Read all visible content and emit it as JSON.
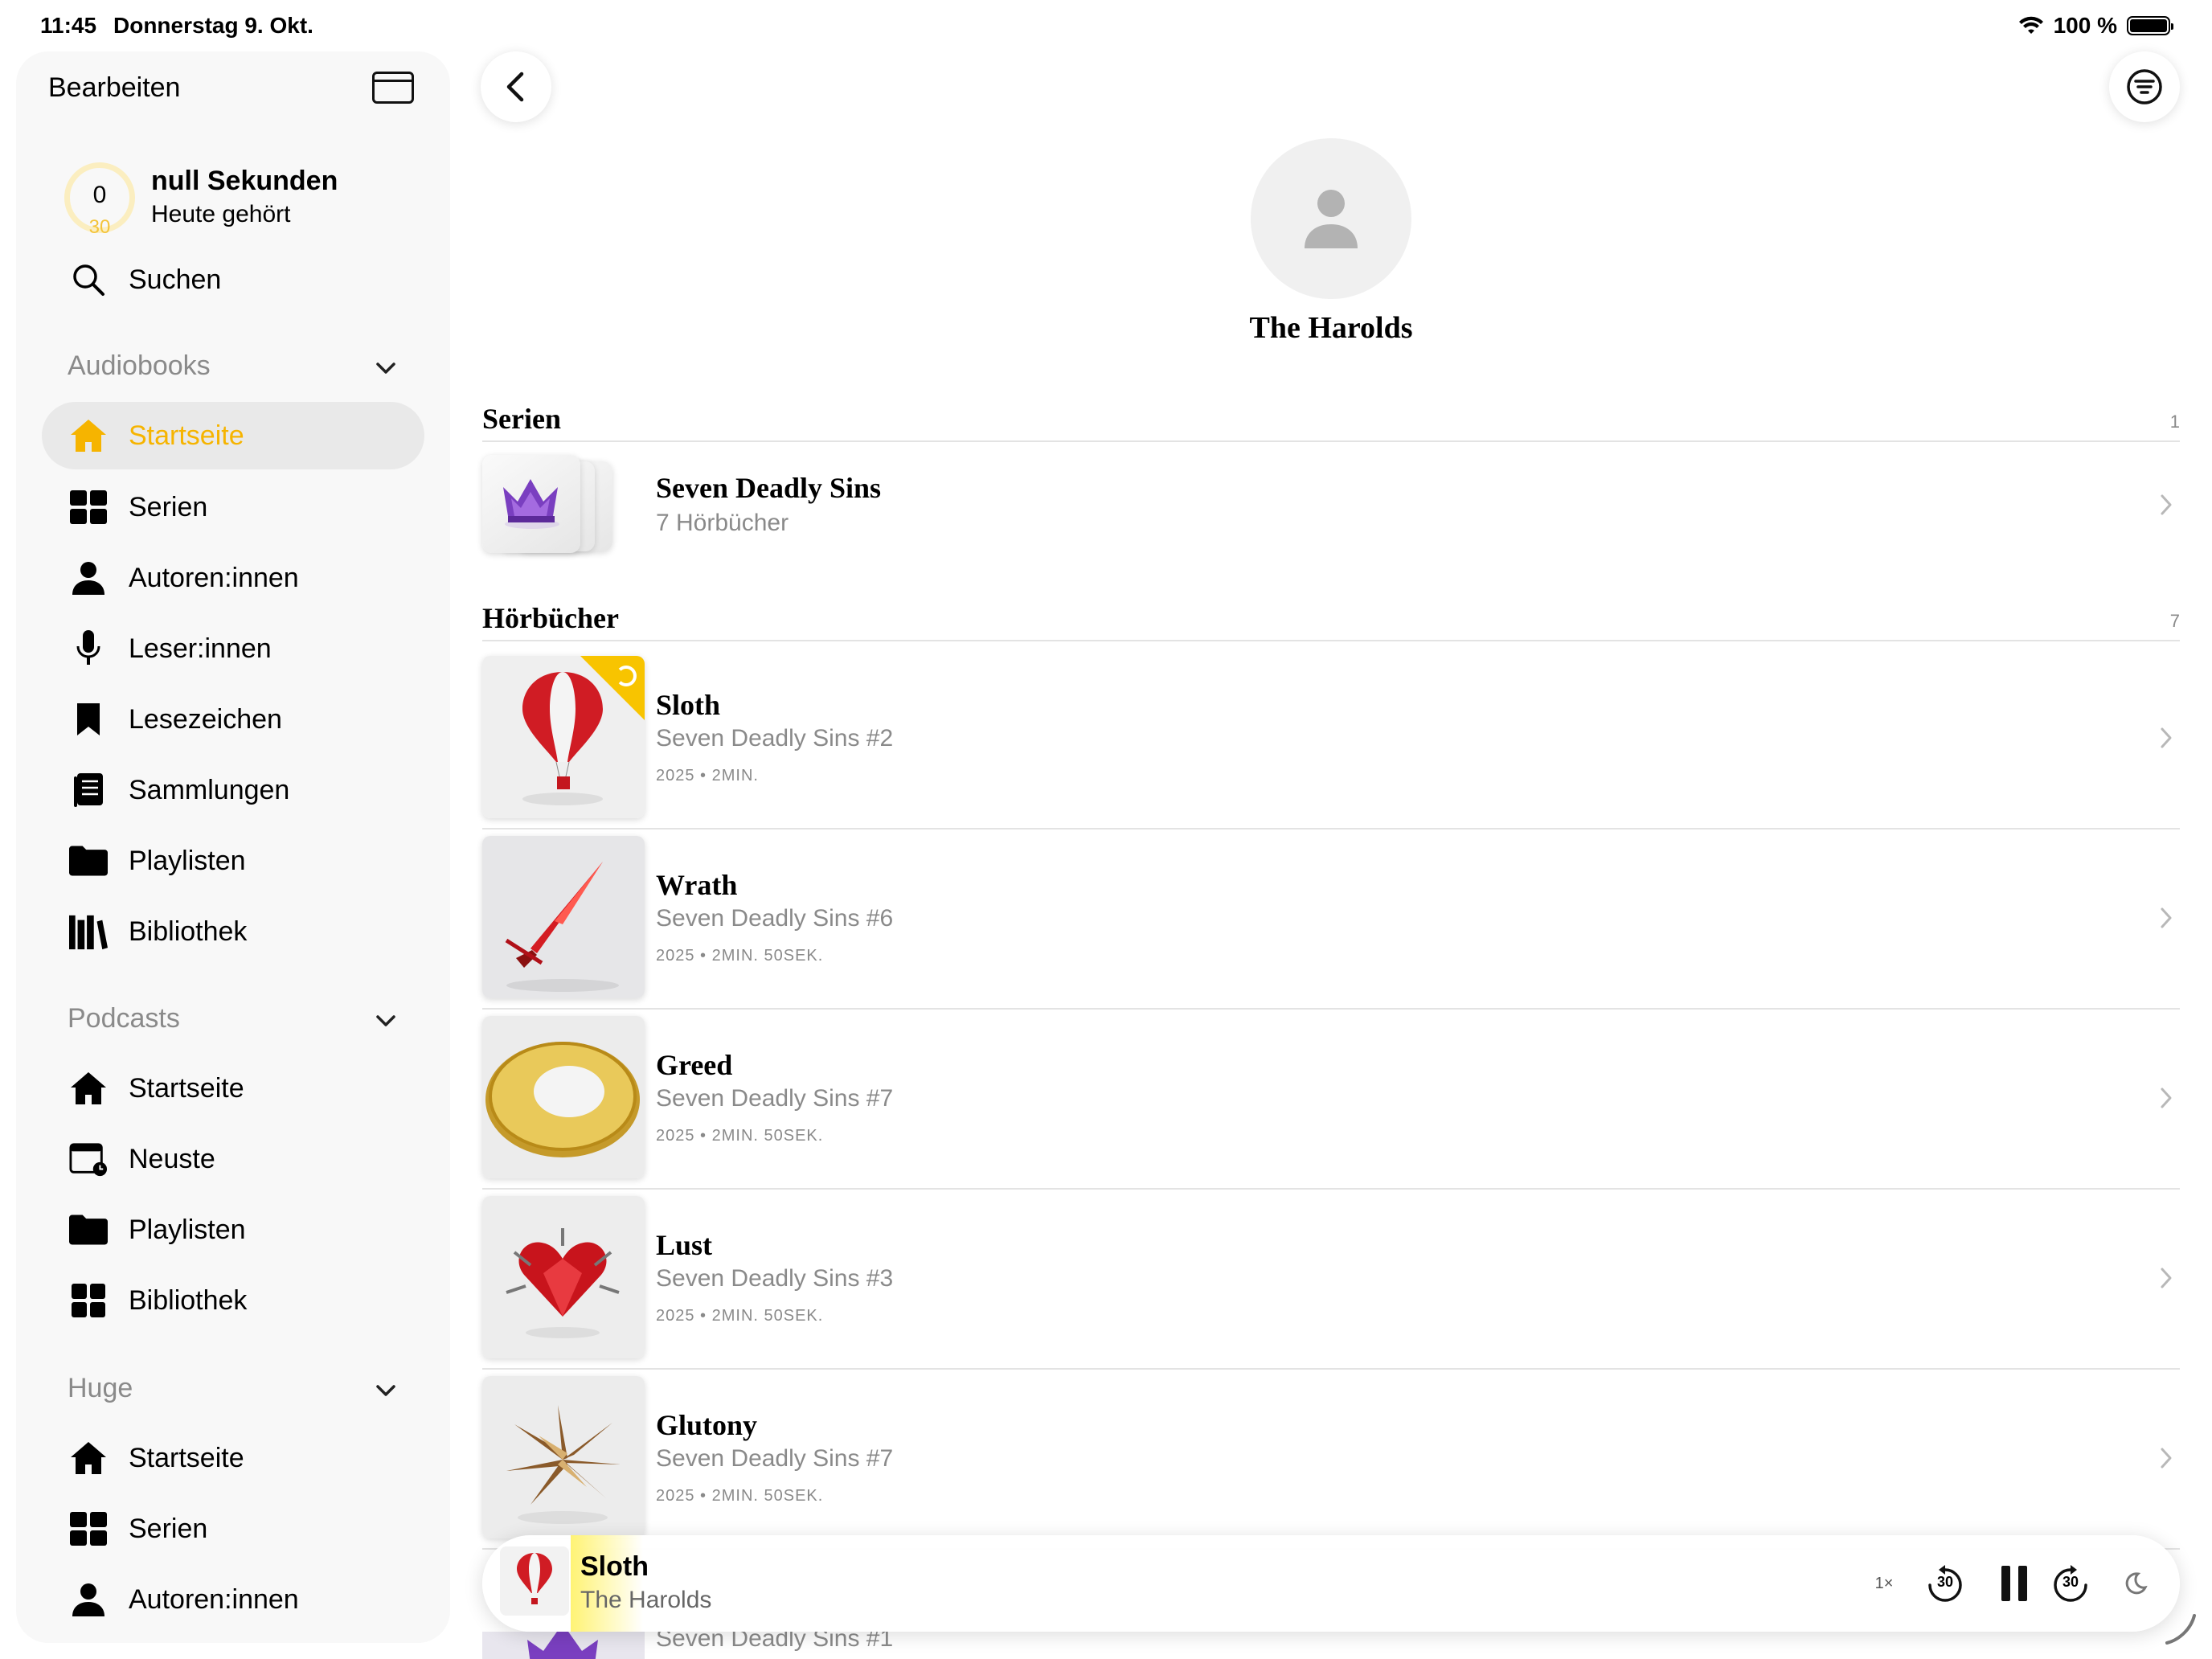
{
  "status": {
    "time": "11:45",
    "date": "Donnerstag 9. Okt.",
    "battery": "100 %"
  },
  "sidebar": {
    "edit": "Bearbeiten",
    "stats": {
      "value": "0",
      "goal": "30",
      "title": "null Sekunden",
      "subtitle": "Heute gehört"
    },
    "search": "Suchen",
    "sections": [
      {
        "title": "Audiobooks",
        "items": [
          "Startseite",
          "Serien",
          "Autoren:innen",
          "Leser:innen",
          "Lesezeichen",
          "Sammlungen",
          "Playlisten",
          "Bibliothek"
        ]
      },
      {
        "title": "Podcasts",
        "items": [
          "Startseite",
          "Neuste",
          "Playlisten",
          "Bibliothek"
        ]
      },
      {
        "title": "Huge",
        "items": [
          "Startseite",
          "Serien",
          "Autoren:innen"
        ]
      }
    ],
    "accent": "#f6b400"
  },
  "author": {
    "name": "The Harolds"
  },
  "series_section": {
    "title": "Serien",
    "count": "1",
    "items": [
      {
        "title": "Seven Deadly Sins",
        "subtitle": "7 Hörbücher"
      }
    ]
  },
  "books_section": {
    "title": "Hörbücher",
    "count": "7",
    "items": [
      {
        "title": "Sloth",
        "series": "Seven Deadly Sins #2",
        "meta": "2025 • 2MIN."
      },
      {
        "title": "Wrath",
        "series": "Seven Deadly Sins #6",
        "meta": "2025 • 2MIN. 50SEK."
      },
      {
        "title": "Greed",
        "series": "Seven Deadly Sins #7",
        "meta": "2025 • 2MIN. 50SEK."
      },
      {
        "title": "Lust",
        "series": "Seven Deadly Sins #3",
        "meta": "2025 • 2MIN. 50SEK."
      },
      {
        "title": "Glutony",
        "series": "Seven Deadly Sins #7",
        "meta": "2025 • 2MIN. 50SEK."
      },
      {
        "series": "Seven Deadly Sins #1"
      }
    ]
  },
  "player": {
    "title": "Sloth",
    "author": "The Harolds",
    "speed": "1×",
    "skip_back": "30",
    "skip_fwd": "30"
  }
}
